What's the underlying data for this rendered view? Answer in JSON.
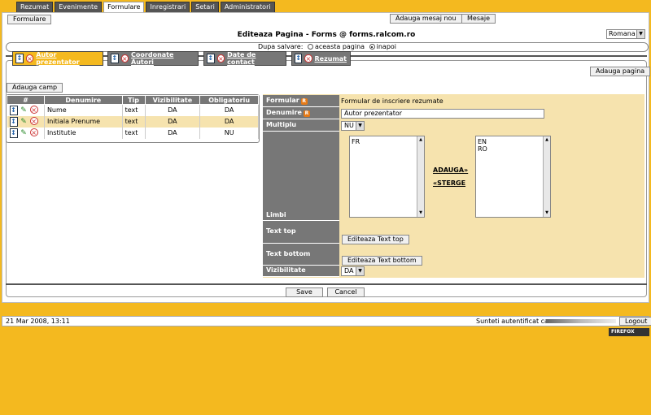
{
  "top_tabs": [
    "Rezumat",
    "Evenimente",
    "Formulare",
    "Inregistrari",
    "Setari",
    "Administratori"
  ],
  "active_top_tab": "Formulare",
  "header_buttons": {
    "add_message": "Adauga mesaj nou",
    "messages": "Mesaje"
  },
  "subtab": "Formulare",
  "page_title": "Editeaza Pagina - Forms @ forms.ralcom.ro",
  "language": "Romana",
  "after_save": {
    "label": "Dupa salvare:",
    "option1": "aceasta pagina",
    "option2": "inapoi",
    "selected": "inapoi"
  },
  "page_tabs": [
    "Autor prezentator",
    "Coordonate Autori",
    "Date de contact",
    "Rezumat"
  ],
  "add_page": "Adauga pagina",
  "add_field": "Adauga camp",
  "fields_table": {
    "headers": [
      "#",
      "Denumire",
      "Tip",
      "Vizibilitate",
      "Obligatoriu"
    ],
    "rows": [
      {
        "name": "Nume",
        "type": "text",
        "visible": "DA",
        "required": "DA"
      },
      {
        "name": "Initiala Prenume",
        "type": "text",
        "visible": "DA",
        "required": "DA"
      },
      {
        "name": "Institutie",
        "type": "text",
        "visible": "DA",
        "required": "NU"
      }
    ]
  },
  "form": {
    "formular_label": "Formular",
    "formular_value": "Formular de inscriere rezumate",
    "denumire_label": "Denumire",
    "denumire_value": "Autor prezentator",
    "multiplu_label": "Multiplu",
    "multiplu_value": "NU",
    "limbi_label": "Limbi",
    "languages_available": [
      "FR"
    ],
    "languages_selected": [
      "EN",
      "RO"
    ],
    "add_link": "ADAUGA»",
    "remove_link": "«STERGE",
    "text_top_label": "Text top",
    "text_top_button": "Editeaza Text top",
    "text_bottom_label": "Text bottom",
    "text_bottom_button": "Editeaza Text bottom",
    "vizibilitate_label": "Vizibilitate",
    "vizibilitate_value": "DA",
    "badge": "R"
  },
  "actions": {
    "save": "Save",
    "cancel": "Cancel"
  },
  "footer": {
    "datetime": "21 Mar 2008, 13:11",
    "auth_label": "Sunteti autentificat ca:",
    "logout": "Logout"
  },
  "browser_badge": "FIREFOX"
}
